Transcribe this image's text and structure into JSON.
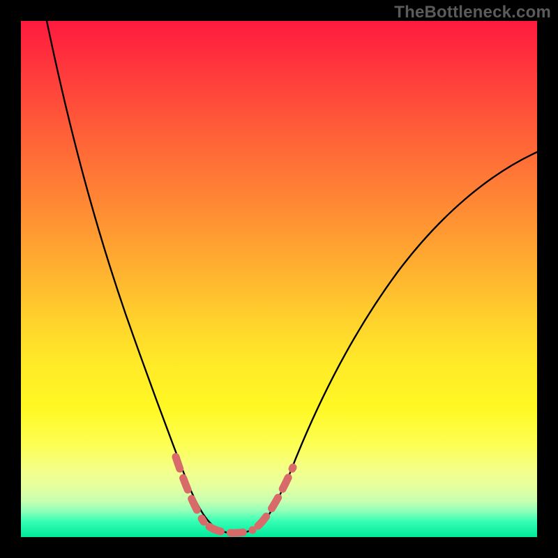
{
  "watermark": "TheBottleneck.com",
  "colors": {
    "background": "#000000",
    "curve_stroke": "#000000",
    "highlight_stroke": "#d86a6a",
    "gradient_stops": [
      "#ff1a3e",
      "#ff3a3c",
      "#ff6038",
      "#ff8a34",
      "#ffb030",
      "#ffd22c",
      "#ffe928",
      "#fff824",
      "#fdff52",
      "#f4ff8a",
      "#e7ff9e",
      "#c7ffb0",
      "#8effb8",
      "#34ffb4",
      "#00e89a"
    ]
  },
  "chart_data": {
    "type": "line",
    "title": "",
    "xlabel": "",
    "ylabel": "",
    "xlim": [
      0,
      100
    ],
    "ylim": [
      0,
      100
    ],
    "series": [
      {
        "name": "bottleneck-curve",
        "x": [
          5,
          10,
          15,
          20,
          25,
          28,
          30,
          32,
          34,
          36,
          38,
          40,
          42,
          44,
          46,
          48,
          55,
          62,
          70,
          78,
          86,
          94,
          100
        ],
        "y": [
          100,
          80,
          62,
          46,
          30,
          20,
          14,
          9,
          5,
          2,
          1,
          1,
          1,
          2,
          4,
          7,
          17,
          27,
          37,
          45,
          52,
          58,
          63
        ]
      }
    ],
    "highlight_segments": [
      {
        "name": "left-descent-dashes",
        "x": [
          28,
          30,
          32,
          34
        ],
        "y": [
          20,
          14,
          9,
          5
        ]
      },
      {
        "name": "valley-floor-dashes",
        "x": [
          36,
          38,
          40,
          42,
          44
        ],
        "y": [
          2,
          1,
          1,
          1,
          2
        ]
      },
      {
        "name": "right-ascent-dashes",
        "x": [
          46,
          48,
          50,
          52
        ],
        "y": [
          4,
          7,
          10,
          12
        ]
      }
    ],
    "optimal_x": 40,
    "optimal_y": 1
  }
}
